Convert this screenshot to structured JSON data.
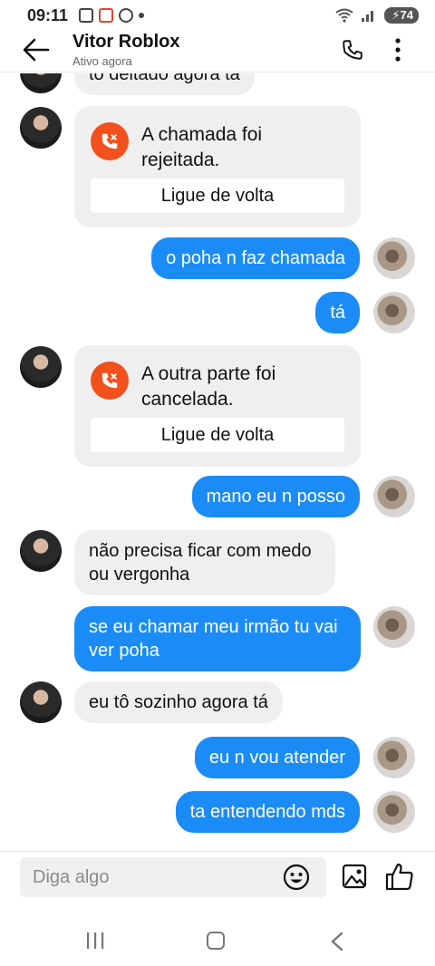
{
  "status": {
    "time": "09:11",
    "battery": "74"
  },
  "header": {
    "title": "Vitor Roblox",
    "subtitle": "Ativo agora"
  },
  "messages": {
    "m0": "to deitado agora tá",
    "call1": {
      "text": "A chamada foi rejeitada.",
      "action": "Ligue de volta"
    },
    "m1": "o poha n faz chamada",
    "m2": "tá",
    "call2": {
      "text": "A outra parte foi cancelada.",
      "action": "Ligue de volta"
    },
    "m3": "mano eu n posso",
    "m4": "não precisa ficar com medo ou vergonha",
    "m5": "se eu chamar meu irmão tu vai ver poha",
    "m6": "eu tô sozinho agora tá",
    "m7": "eu n vou atender",
    "m8": "ta entendendo mds"
  },
  "composer": {
    "placeholder": "Diga algo"
  },
  "colors": {
    "accent": "#1b8cf6",
    "incoming": "#efefef",
    "call_icon": "#f2511b"
  }
}
